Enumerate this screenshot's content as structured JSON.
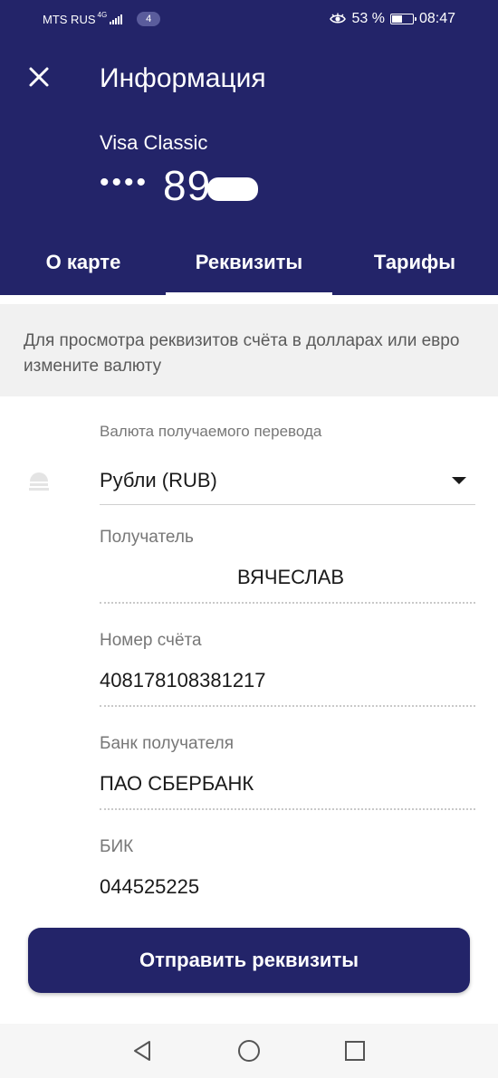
{
  "status_bar": {
    "carrier": "MTS RUS",
    "network": "4G",
    "notification_count": "4",
    "battery_percent": "53 %",
    "battery_level": 0.53,
    "time": "08:47"
  },
  "header": {
    "title": "Информация",
    "card_name": "Visa Classic",
    "card_mask_dots": "••••",
    "card_number_visible": "89"
  },
  "tabs": [
    {
      "label": "О карте",
      "active": false
    },
    {
      "label": "Реквизиты",
      "active": true
    },
    {
      "label": "Тарифы",
      "active": false
    }
  ],
  "info_banner": "Для просмотра реквизитов счёта в долларах или евро измените валюту",
  "form": {
    "currency": {
      "label": "Валюта получаемого перевода",
      "value": "Рубли (RUB)"
    },
    "recipient": {
      "label": "Получатель",
      "value": "ВЯЧЕСЛАВ"
    },
    "account": {
      "label": "Номер счёта",
      "value": "408178108381217"
    },
    "bank": {
      "label": "Банк получателя",
      "value": "ПАО СБЕРБАНК"
    },
    "bik": {
      "label": "БИК",
      "value": "044525225"
    }
  },
  "send_button": "Отправить реквизиты",
  "colors": {
    "primary": "#232469",
    "banner_bg": "#f1f1f1",
    "label": "#777777"
  }
}
